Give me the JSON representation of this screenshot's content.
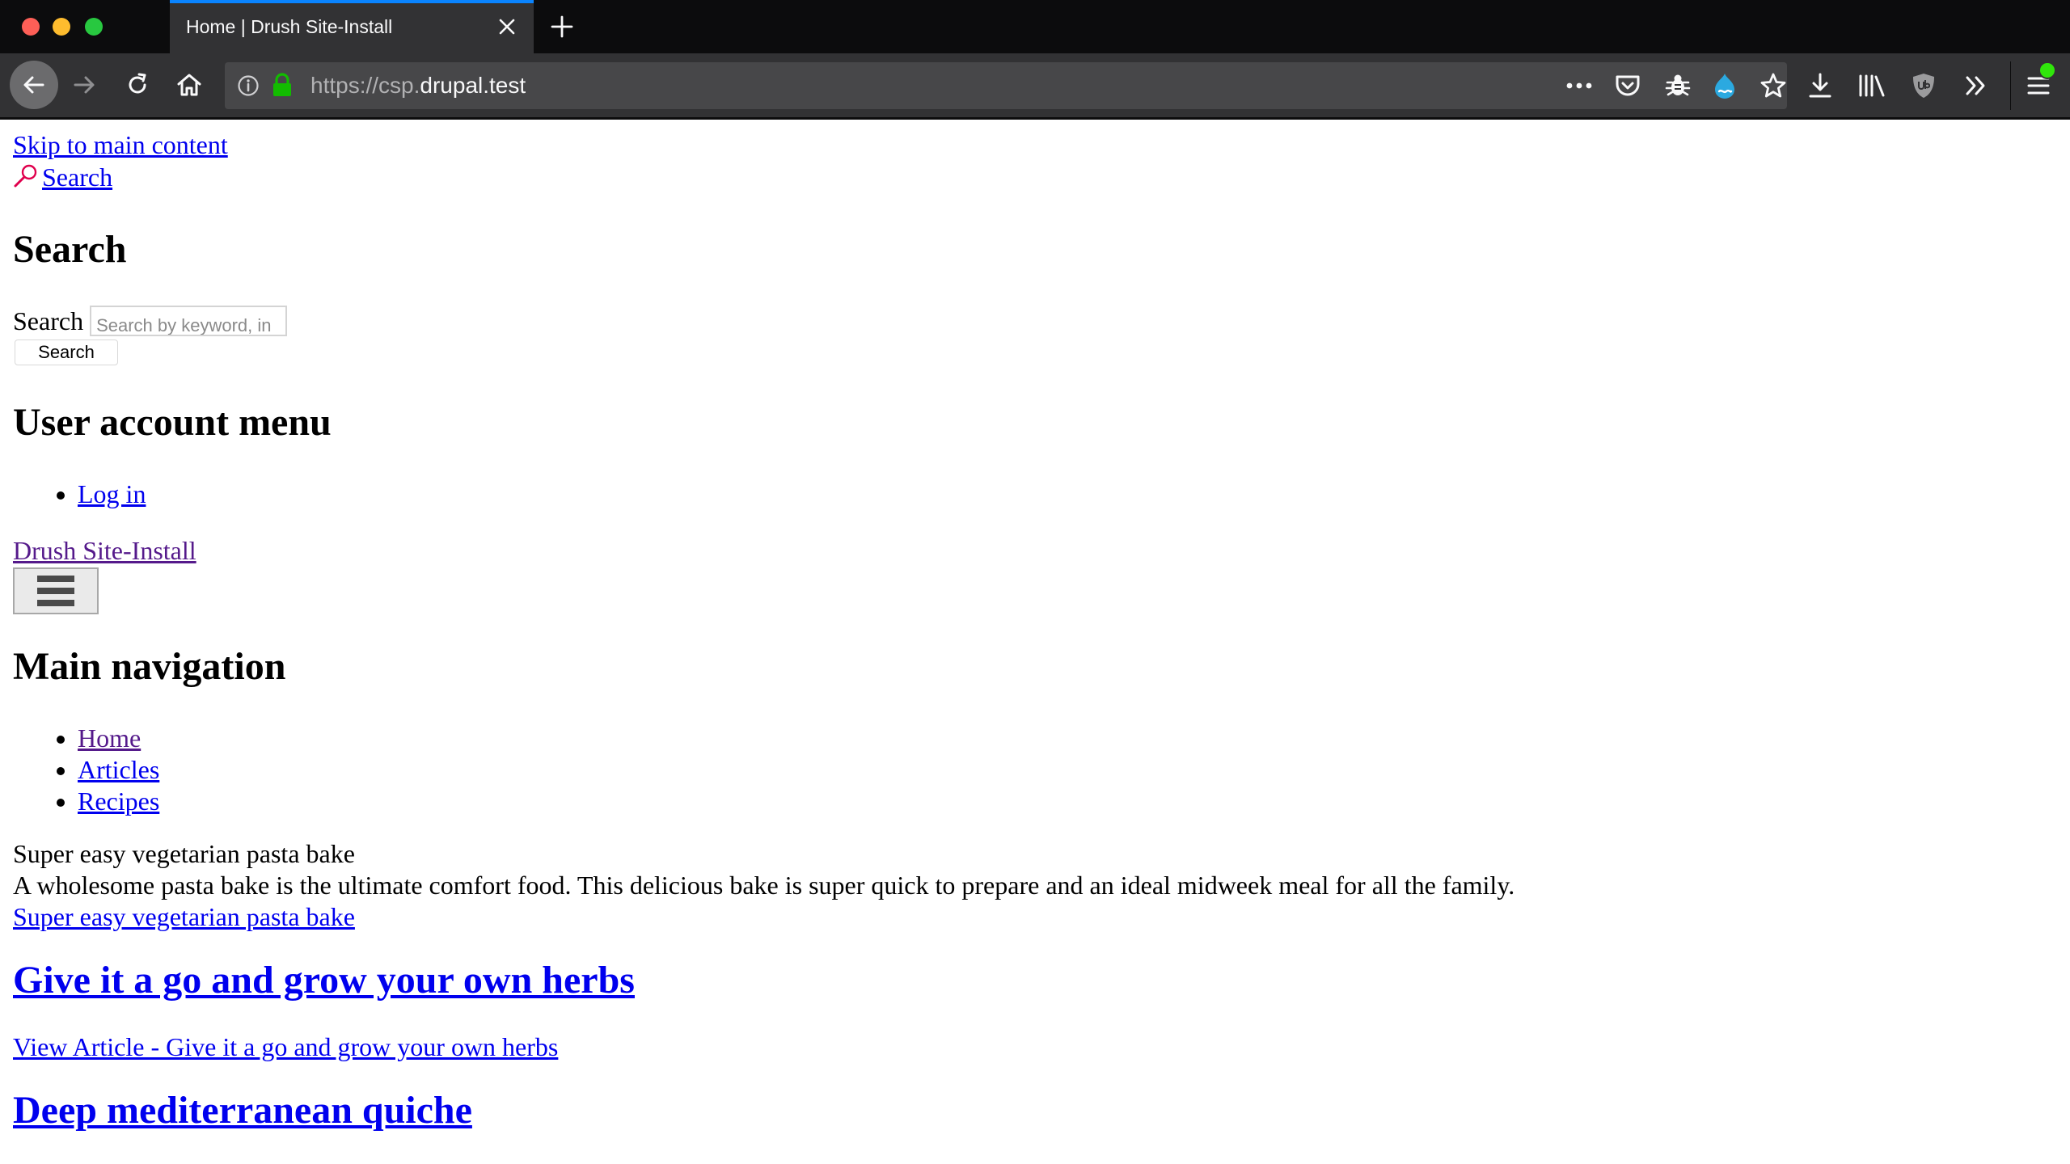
{
  "browser": {
    "tab_title": "Home | Drush Site-Install",
    "url_scheme": "https://csp.",
    "url_host": "drupal.test",
    "accent_color": "#0a84ff",
    "icons": {
      "back": "back-arrow-icon",
      "forward": "forward-arrow-icon",
      "reload": "reload-icon",
      "home": "home-icon",
      "info": "info-icon",
      "lock": "lock-icon",
      "more": "more-dots-icon",
      "pocket": "pocket-icon",
      "bug": "bug-icon",
      "drupal": "drupal-icon",
      "star": "bookmark-star-icon",
      "download": "download-icon",
      "library": "library-icon",
      "ublock": "ublock-icon",
      "overflow": "overflow-chevron-icon",
      "menu": "hamburger-menu-icon"
    }
  },
  "page": {
    "skip_link": "Skip to main content",
    "search_toggle": "Search",
    "search_heading": "Search",
    "search_label": "Search",
    "search_placeholder": "Search by keyword, in",
    "search_button": "Search",
    "user_menu_heading": "User account menu",
    "user_menu_items": [
      "Log in"
    ],
    "site_name": "Drush Site-Install",
    "main_nav_heading": "Main navigation",
    "main_nav_items": [
      "Home",
      "Articles",
      "Recipes"
    ],
    "teaser": {
      "title": "Super easy vegetarian pasta bake",
      "summary": "A wholesome pasta bake is the ultimate comfort food. This delicious bake is super quick to prepare and an ideal midweek meal for all the family.",
      "link": "Super easy vegetarian pasta bake"
    },
    "article_heading": "Give it a go and grow your own herbs",
    "view_article_link": "View Article - Give it a go and grow your own herbs",
    "next_heading": "Deep mediterranean quiche"
  }
}
